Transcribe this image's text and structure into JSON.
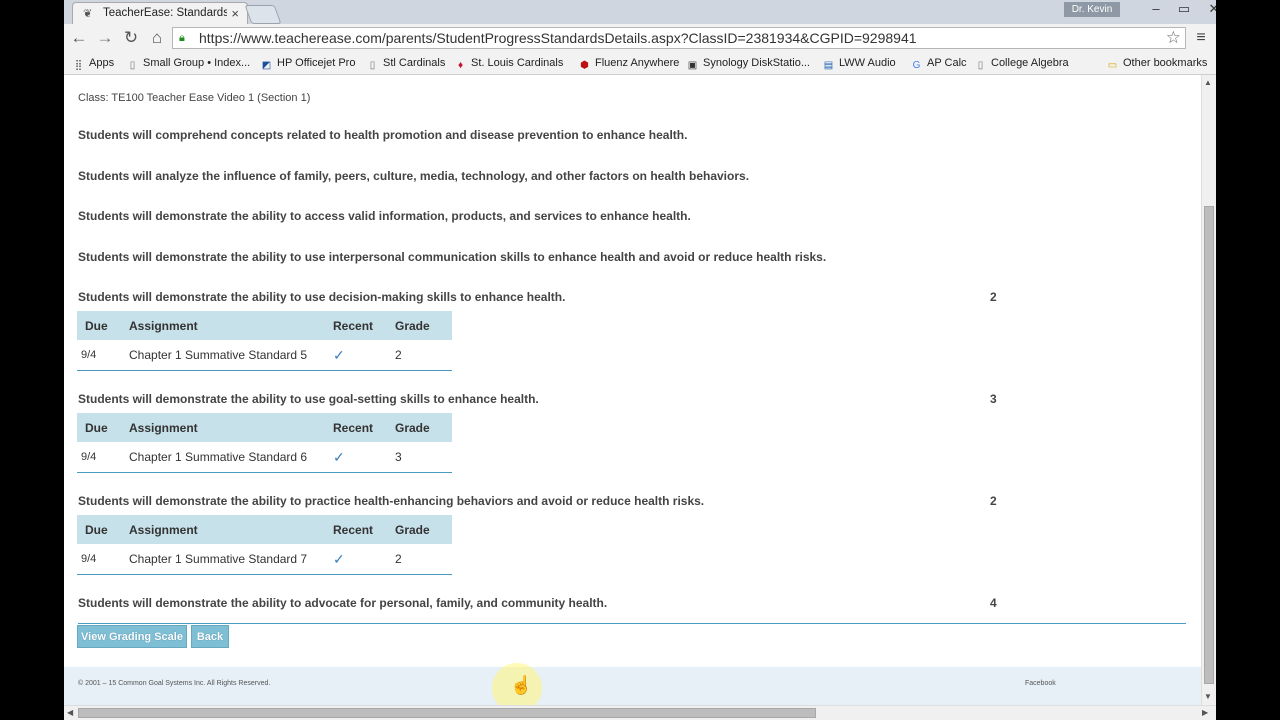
{
  "browser": {
    "tab_title": "TeacherEase: Standards-B",
    "tab_close": "×",
    "user_label": "Dr. Kevin",
    "win_min": "–",
    "win_max": "▭",
    "win_close": "✕",
    "url": "https://www.teacherease.com/parents/StudentProgressStandardsDetails.aspx?ClassID=2381934&CGPID=9298941",
    "bookmarks": [
      {
        "label": "Apps",
        "icon": "apps-icon"
      },
      {
        "label": "Small Group • Index...",
        "icon": "page-icon"
      },
      {
        "label": "HP Officejet Pro",
        "icon": "hp-icon"
      },
      {
        "label": "Stl Cardinals",
        "icon": "page-icon"
      },
      {
        "label": "St. Louis Cardinals",
        "icon": "cardinals-icon"
      },
      {
        "label": "Fluenz Anywhere",
        "icon": "fluenz-icon"
      },
      {
        "label": "Synology DiskStatio...",
        "icon": "synology-icon"
      },
      {
        "label": "LWW Audio",
        "icon": "dsm-icon"
      },
      {
        "label": "AP Calc",
        "icon": "google-icon"
      },
      {
        "label": "College Algebra",
        "icon": "page-icon"
      },
      {
        "label": "Other bookmarks",
        "icon": "folder-icon"
      }
    ]
  },
  "page": {
    "class_line": "Class: TE100 Teacher Ease Video 1 (Section 1)",
    "standards": [
      {
        "text": "Students will comprehend concepts related to health promotion and disease prevention to enhance health.",
        "score": ""
      },
      {
        "text": "Students will analyze the influence of family, peers, culture, media, technology, and other factors on health behaviors.",
        "score": ""
      },
      {
        "text": "Students will demonstrate the ability to access valid information, products, and services to enhance health.",
        "score": ""
      },
      {
        "text": "Students will demonstrate the ability to use interpersonal communication skills to enhance health and avoid or reduce health risks.",
        "score": ""
      },
      {
        "text": "Students will demonstrate the ability to use decision-making skills to enhance health.",
        "score": "2"
      },
      {
        "text": "Students will demonstrate the ability to use goal-setting skills to enhance health.",
        "score": "3"
      },
      {
        "text": "Students will demonstrate the ability to practice health-enhancing behaviors and avoid or reduce health risks.",
        "score": "2"
      },
      {
        "text": "Students will demonstrate the ability to advocate for personal, family, and community health.",
        "score": "4"
      }
    ],
    "table_headers": {
      "due": "Due",
      "assignment": "Assignment",
      "recent": "Recent",
      "grade": "Grade"
    },
    "assignments": [
      {
        "due": "9/4",
        "assignment": "Chapter 1 Summative Standard 5",
        "recent": "✓",
        "grade": "2"
      },
      {
        "due": "9/4",
        "assignment": "Chapter 1 Summative Standard 6",
        "recent": "✓",
        "grade": "3"
      },
      {
        "due": "9/4",
        "assignment": "Chapter 1 Summative Standard 7",
        "recent": "✓",
        "grade": "2"
      }
    ],
    "buttons": {
      "grading_scale": "View Grading Scale",
      "back": "Back"
    },
    "footer": {
      "copyright": "© 2001 – 15 Common Goal Systems Inc. All Rights Reserved.",
      "facebook": "Facebook"
    }
  },
  "colors": {
    "header_bg": "#c7e1ea",
    "accent": "#4a9bc0",
    "button_bg": "#7fbfd6",
    "footer_bg": "#e6f0f6"
  }
}
